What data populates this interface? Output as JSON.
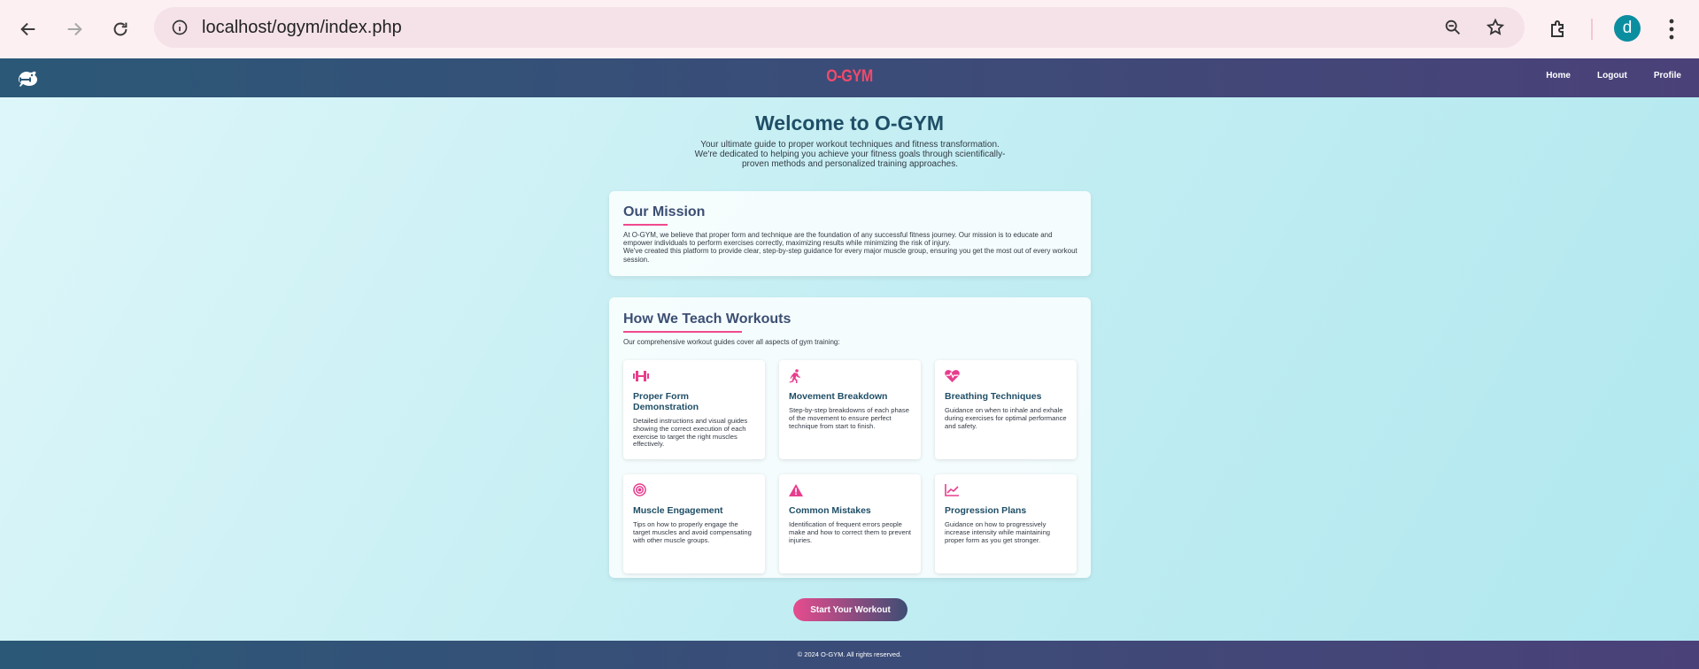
{
  "browser": {
    "url": "localhost/ogym/index.php",
    "profile_initial": "d"
  },
  "header": {
    "brand": "O-GYM",
    "nav": [
      "Home",
      "Logout",
      "Profile"
    ]
  },
  "hero": {
    "title": "Welcome to O-GYM",
    "line1": "Your ultimate guide to proper workout techniques and fitness transformation.",
    "line2": "We're dedicated to helping you achieve your fitness goals through scientifically-",
    "line3": "proven methods and personalized training approaches."
  },
  "mission": {
    "title": "Our Mission",
    "p1": "At O-GYM, we believe that proper form and technique are the foundation of any successful fitness journey. Our mission is to educate and empower individuals to perform exercises correctly, maximizing results while minimizing the risk of injury.",
    "p2": "We've created this platform to provide clear, step-by-step guidance for every major muscle group, ensuring you get the most out of every workout session."
  },
  "teach": {
    "title": "How We Teach Workouts",
    "intro": "Our comprehensive workout guides cover all aspects of gym training:",
    "features": [
      {
        "icon": "dumbbell-icon",
        "title": "Proper Form Demonstration",
        "desc": "Detailed instructions and visual guides showing the correct execution of each exercise to target the right muscles effectively."
      },
      {
        "icon": "running-icon",
        "title": "Movement Breakdown",
        "desc": "Step-by-step breakdowns of each phase of the movement to ensure perfect technique from start to finish."
      },
      {
        "icon": "heartbeat-icon",
        "title": "Breathing Techniques",
        "desc": "Guidance on when to inhale and exhale during exercises for optimal performance and safety."
      },
      {
        "icon": "target-icon",
        "title": "Muscle Engagement",
        "desc": "Tips on how to properly engage the target muscles and avoid compensating with other muscle groups."
      },
      {
        "icon": "warning-icon",
        "title": "Common Mistakes",
        "desc": "Identification of frequent errors people make and how to correct them to prevent injuries."
      },
      {
        "icon": "chart-line-icon",
        "title": "Progression Plans",
        "desc": "Guidance on how to progressively increase intensity while maintaining proper form as you get stronger."
      }
    ]
  },
  "cta": {
    "label": "Start Your Workout"
  },
  "footer": {
    "text": "© 2024 O-GYM. All rights reserved."
  },
  "colors": {
    "accent": "#e83d8d",
    "brand": "#f04a6d",
    "header_start": "#2b5877",
    "header_end": "#4a4179"
  }
}
